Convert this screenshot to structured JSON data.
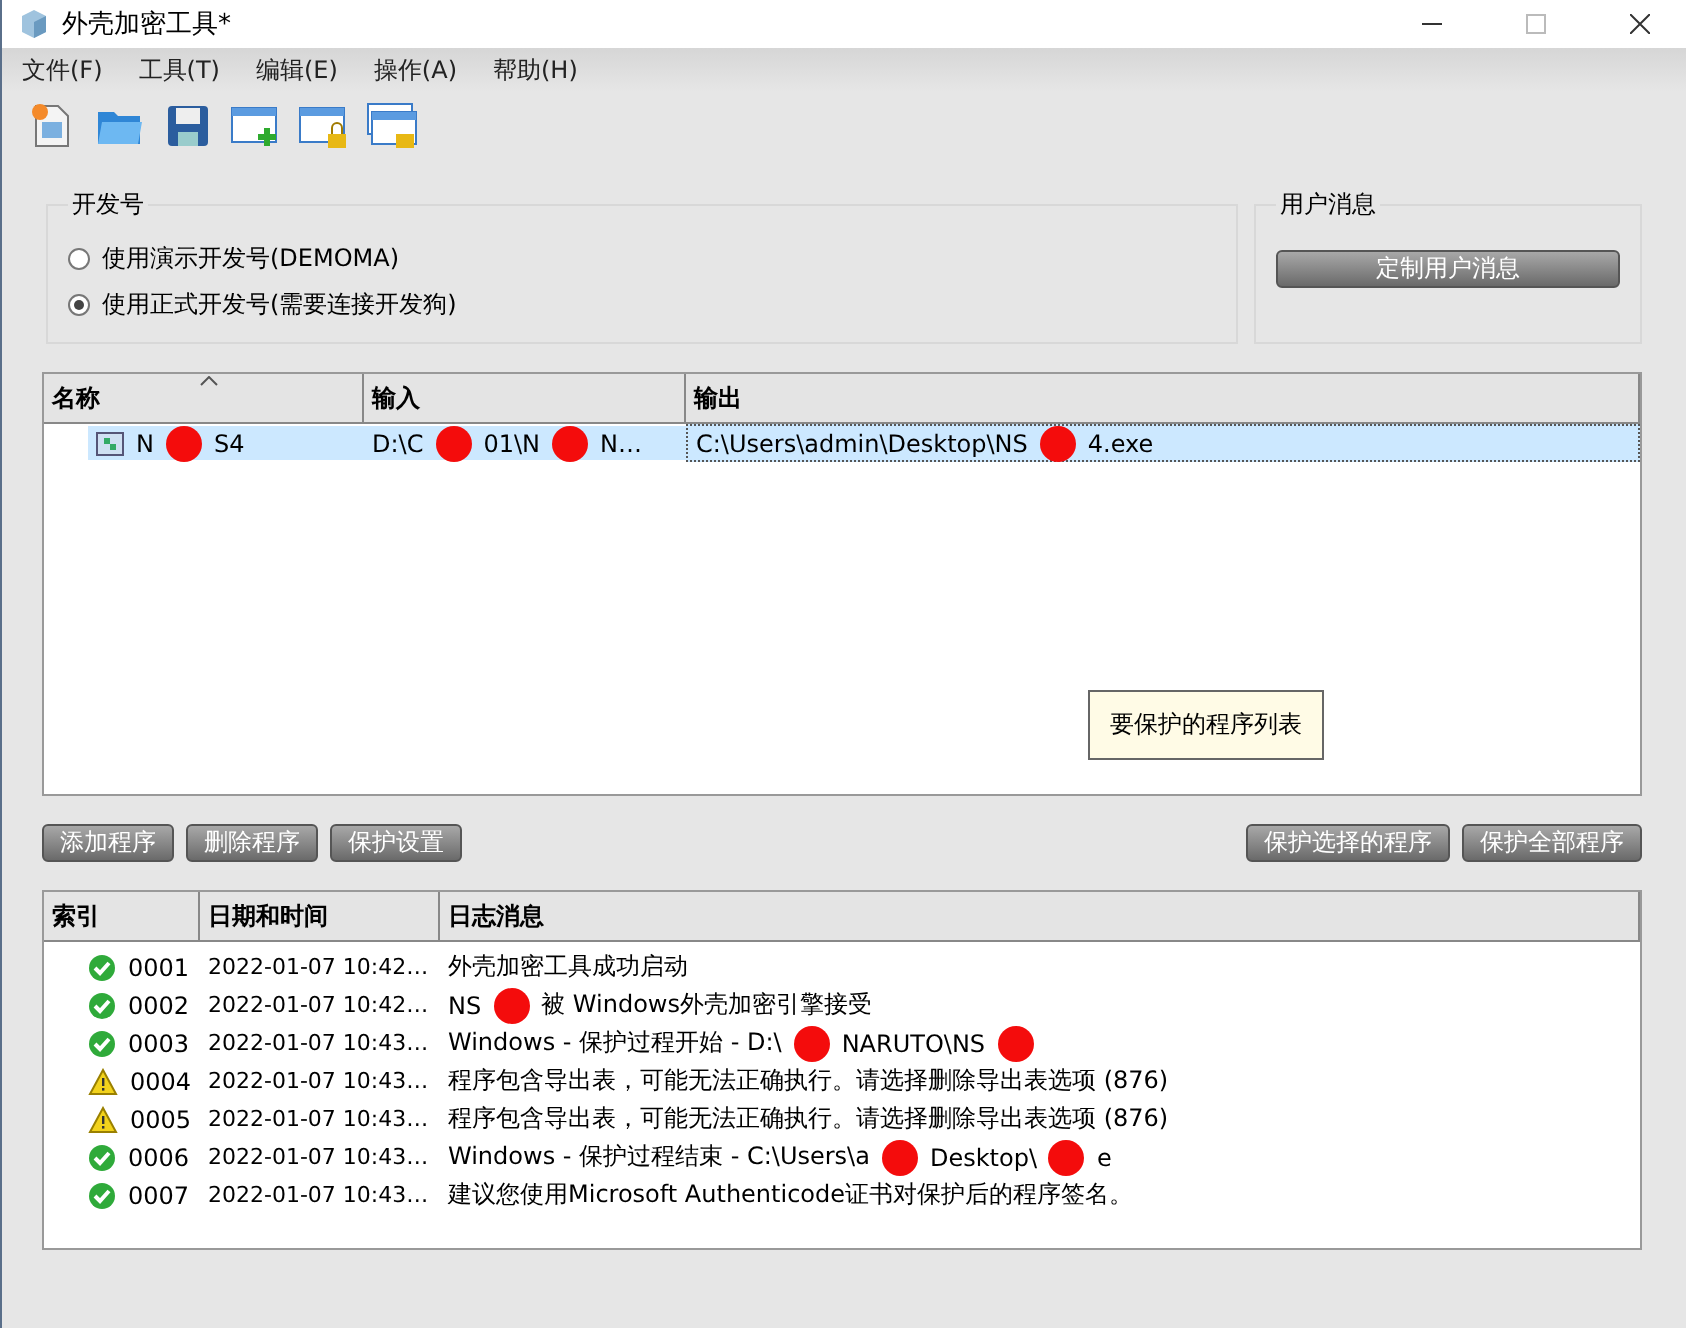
{
  "window": {
    "title": "外壳加密工具*"
  },
  "menu": [
    "文件(F)",
    "工具(T)",
    "编辑(E)",
    "操作(A)",
    "帮助(H)"
  ],
  "toolbar": [
    {
      "kind": "new"
    },
    {
      "kind": "open"
    },
    {
      "kind": "save"
    },
    {
      "kind": "add"
    },
    {
      "kind": "lock"
    },
    {
      "kind": "lockall"
    }
  ],
  "developer": {
    "title": "开发号",
    "options": [
      {
        "label": "使用演示开发号(DEMOMA)",
        "selected": false
      },
      {
        "label": "使用正式开发号(需要连接开发狗)",
        "selected": true
      }
    ]
  },
  "user_message": {
    "title": "用户消息",
    "button": "定制用户消息"
  },
  "program_table": {
    "columns": [
      "名称",
      "输入",
      "输出"
    ],
    "rows": [
      {
        "selected": true,
        "cells": [
          [
            "N",
            "S4"
          ],
          [
            "D:\\C",
            "01\\N",
            "N…"
          ],
          [
            "C:\\Users\\admin\\Desktop\\NS",
            "4.exe"
          ]
        ]
      }
    ],
    "tooltip": "要保护的程序列表"
  },
  "left_buttons": [
    "添加程序",
    "删除程序",
    "保护设置"
  ],
  "right_buttons": [
    "保护选择的程序",
    "保护全部程序"
  ],
  "log_table": {
    "columns": [
      "索引",
      "日期和时间",
      "日志消息"
    ],
    "rows": [
      {
        "kind": "ok",
        "index": "0001",
        "time": "2022-01-07 10:42…",
        "message": [
          "外壳加密工具成功启动"
        ]
      },
      {
        "kind": "ok",
        "index": "0002",
        "time": "2022-01-07 10:42…",
        "message": [
          "NS",
          "被 Windows外壳加密引擎接受"
        ]
      },
      {
        "kind": "ok",
        "index": "0003",
        "time": "2022-01-07 10:43…",
        "message": [
          "Windows - 保护过程开始 - D:\\",
          "NARUTO\\NS"
        ],
        "trailing_redaction": true
      },
      {
        "kind": "warning",
        "index": "0004",
        "time": "2022-01-07 10:43…",
        "message": [
          "程序包含导出表，可能无法正确执行。请选择删除导出表选项 (876)"
        ]
      },
      {
        "kind": "warning",
        "index": "0005",
        "time": "2022-01-07 10:43…",
        "message": [
          "程序包含导出表，可能无法正确执行。请选择删除导出表选项 (876)"
        ]
      },
      {
        "kind": "ok",
        "index": "0006",
        "time": "2022-01-07 10:43…",
        "message": [
          "Windows - 保护过程结束 - C:\\Users\\a",
          "Desktop\\",
          "e"
        ]
      },
      {
        "kind": "ok",
        "index": "0007",
        "time": "2022-01-07 10:43…",
        "message": [
          "建议您使用Microsoft Authenticode证书对保护后的程序签名。"
        ]
      }
    ]
  }
}
